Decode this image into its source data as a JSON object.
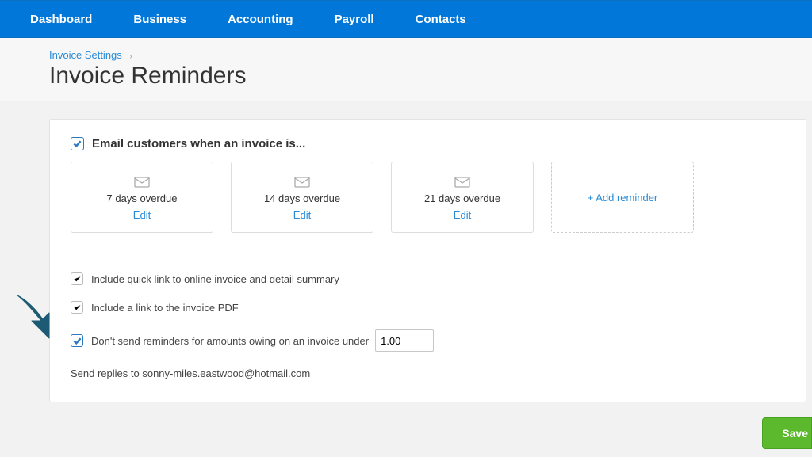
{
  "nav": {
    "items": [
      "Dashboard",
      "Business",
      "Accounting",
      "Payroll",
      "Contacts"
    ]
  },
  "breadcrumb": "Invoice Settings",
  "page_title": "Invoice Reminders",
  "section": {
    "email_customers_label": "Email customers when an invoice is..."
  },
  "reminders": [
    {
      "days": "7 days overdue",
      "edit": "Edit"
    },
    {
      "days": "14 days overdue",
      "edit": "Edit"
    },
    {
      "days": "21 days overdue",
      "edit": "Edit"
    }
  ],
  "add_reminder_label": "+ Add reminder",
  "options": {
    "quick_link": "Include quick link to online invoice and detail summary",
    "pdf_link": "Include a link to the invoice PDF",
    "min_amount_label": "Don't send reminders for amounts owing on an invoice under",
    "min_amount_value": "1.00"
  },
  "reply_to": "Send replies to sonny-miles.eastwood@hotmail.com",
  "save_label": "Save"
}
